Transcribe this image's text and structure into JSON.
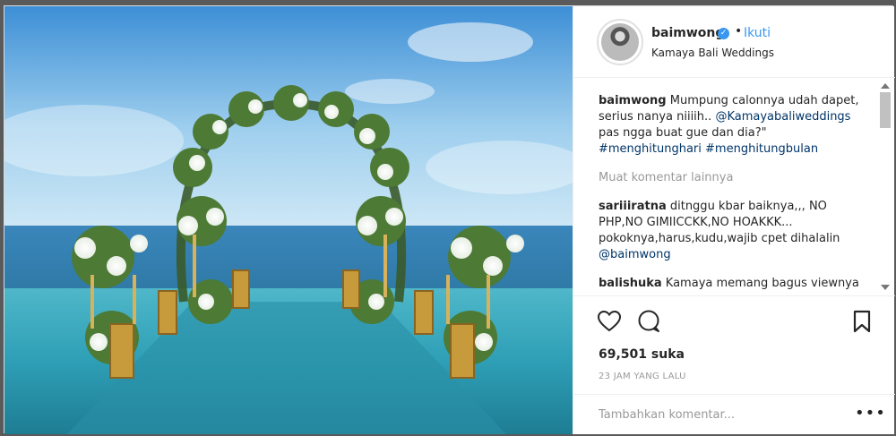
{
  "post": {
    "username": "baimwong",
    "follow_label": "Ikuti",
    "separator": "•",
    "location": "Kamaya Bali Weddings",
    "caption": {
      "username": "baimwong",
      "text_1": "Mumpung calonnya udah dapet, serius nanya niiiih..",
      "mention": "@Kamayabaliweddings",
      "text_2": "pas ngga buat gue dan dia?\"",
      "hashtag_1": "#menghitunghari",
      "hashtag_2": "#menghitungbulan"
    },
    "load_more": "Muat komentar lainnya",
    "comments": [
      {
        "username": "sariiiratna",
        "text": "ditnggu kbar baiknya,,, NO PHP,NO GIMIICCKK,NO HOAKKK... pokoknya,harus,kudu,wajib cpet dihalalin",
        "mention": "@baimwong"
      },
      {
        "username": "balishuka",
        "text": "Kamaya memang bagus viewnya"
      }
    ],
    "likes": "69,501 suka",
    "time": "23 JAM YANG LALU",
    "add_comment_placeholder": "Tambahkan komentar...",
    "options_icon": "•••"
  },
  "icons": {
    "verified": "verified-badge-icon",
    "like": "heart-icon",
    "comment": "speech-bubble-icon",
    "save": "bookmark-icon"
  },
  "colors": {
    "accent": "#3897f0",
    "hashtag": "#003569",
    "muted": "#999999"
  }
}
